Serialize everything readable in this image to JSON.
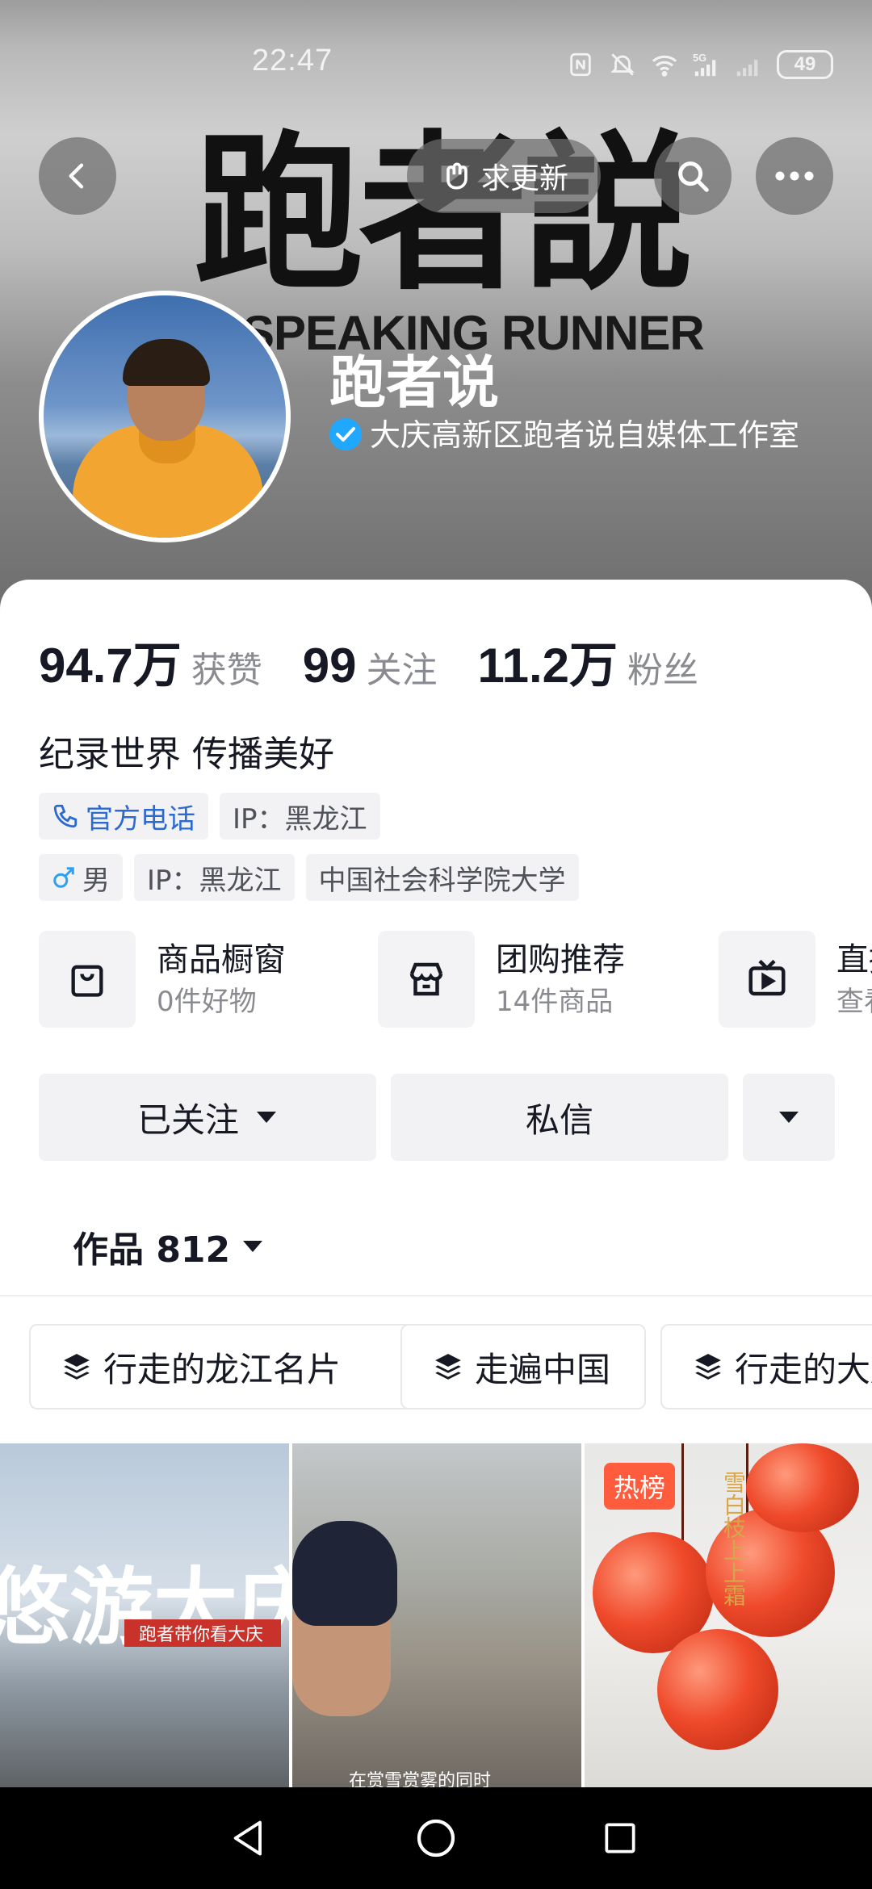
{
  "status_bar": {
    "time": "22:47",
    "battery": "49",
    "icons": [
      "nfc-icon",
      "mute-icon",
      "wifi-icon",
      "signal-5g-icon",
      "signal-icon"
    ]
  },
  "header": {
    "banner_title_cn": "跑者説",
    "banner_title_en": "SPEAKING RUNNER",
    "update_button_label": "求更新",
    "icons": [
      "back-icon",
      "search-icon",
      "more-icon"
    ]
  },
  "profile": {
    "name": "跑者说",
    "verification": "大庆高新区跑者说自媒体工作室"
  },
  "stats": [
    {
      "value": "94.7万",
      "label": "获赞"
    },
    {
      "value": "99",
      "label": "关注"
    },
    {
      "value": "11.2万",
      "label": "粉丝"
    }
  ],
  "bio": "纪录世界 传播美好",
  "tags_row1": {
    "phone": "官方电话",
    "ip": "IP：黑龙江"
  },
  "tags_row2": {
    "gender": "男",
    "ip": "IP：黑龙江",
    "school": "中国社会科学院大学"
  },
  "services": [
    {
      "title": "商品橱窗",
      "subtitle": "0件好物",
      "icon": "shopping-bag-icon"
    },
    {
      "title": "团购推荐",
      "subtitle": "14件商品",
      "icon": "store-icon"
    },
    {
      "title": "直播",
      "subtitle": "查看",
      "icon": "tv-icon"
    }
  ],
  "actions": {
    "follow_label": "已关注",
    "message_label": "私信"
  },
  "works_tab": {
    "label": "作品 812"
  },
  "collections": [
    {
      "label": "行走的龙江名片"
    },
    {
      "label": "走遍中国"
    },
    {
      "label": "行走的大庆"
    }
  ],
  "videos": [
    {
      "overlay_text": "悠游大庆",
      "banner_text": "跑者带你看大庆"
    },
    {
      "caption": "在赏雪赏雾的同时"
    },
    {
      "badge": "热榜",
      "overlay_text": "雪白枝上上霜"
    }
  ],
  "colors": {
    "accent_blue": "#2b6ad1",
    "verify_blue": "#20a8ff",
    "hot_badge": "#fe5c3c"
  }
}
